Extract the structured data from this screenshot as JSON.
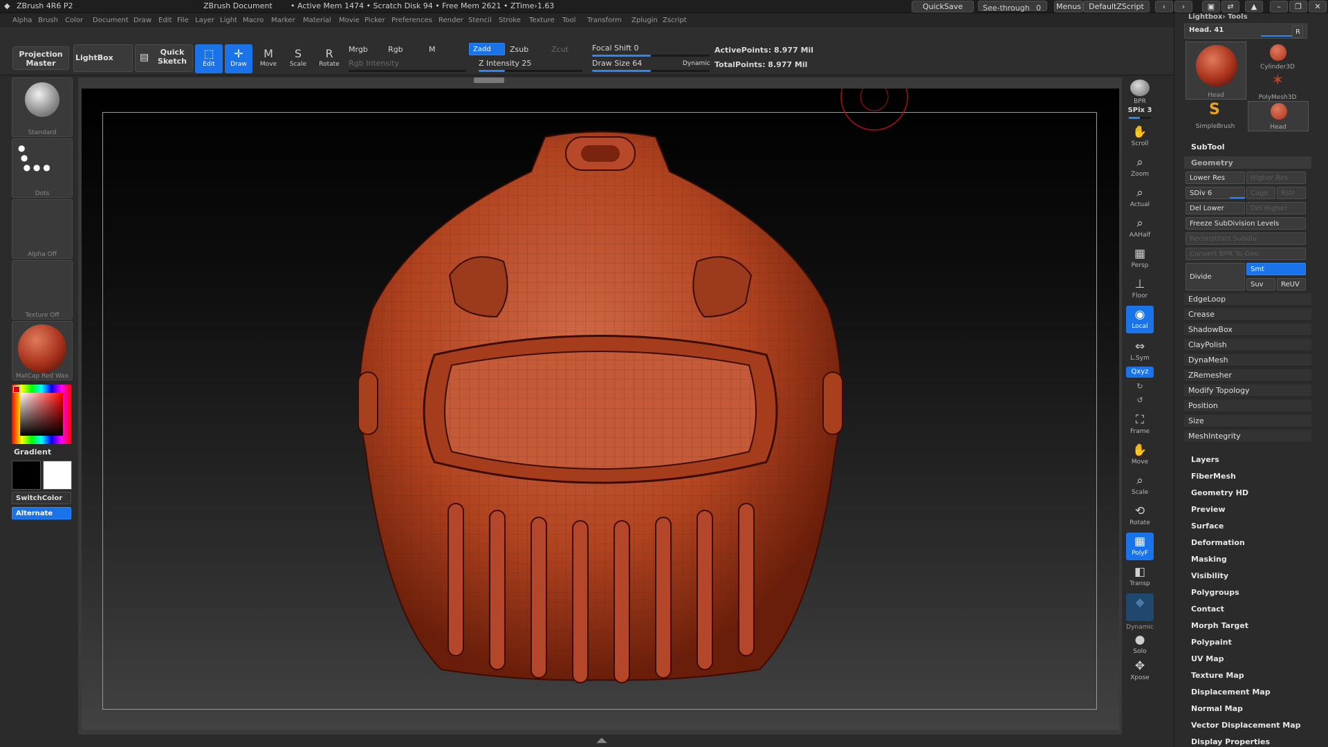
{
  "titlebar": {
    "app": "ZBrush 4R6 P2",
    "document": "ZBrush Document",
    "stats": "• Active Mem 1474 • Scratch Disk 94 • Free Mem 2621 • ZTime›1.63",
    "quicksave": "QuickSave",
    "seethrough": "See-through",
    "seethrough_value": "0",
    "menus": "Menus",
    "script": "DefaultZScript"
  },
  "menubar": [
    "Alpha",
    "Brush",
    "Color",
    "Document",
    "Draw",
    "Edit",
    "File",
    "Layer",
    "Light",
    "Macro",
    "Marker",
    "Material",
    "Movie",
    "Picker",
    "Preferences",
    "Render",
    "Stencil",
    "Stroke",
    "Texture",
    "Tool",
    "Transform",
    "Zplugin",
    "Zscript"
  ],
  "toolbar": {
    "projection_master": "Projection Master",
    "lightbox": "LightBox",
    "quick_sketch": "Quick Sketch",
    "edit": "Edit",
    "draw": "Draw",
    "move": "Move",
    "scale": "Scale",
    "rotate": "Rotate",
    "mrgb": "Mrgb",
    "rgb": "Rgb",
    "m": "M",
    "rgb_intensity": "Rgb Intensity",
    "zadd": "Zadd",
    "zsub": "Zsub",
    "zcut": "Zcut",
    "z_intensity": "Z Intensity 25",
    "focal_shift": "Focal Shift 0",
    "draw_size": "Draw Size 64",
    "dynamic": "Dynamic",
    "active_points": "ActivePoints: 8.977 Mil",
    "total_points": "TotalPoints: 8.977 Mil"
  },
  "toolbar_levels": {
    "z_intensity": 0.25,
    "focal_shift": 0.5,
    "draw_size": 0.5
  },
  "left": {
    "brush": "Standard",
    "stroke": "Dots",
    "alpha": "Alpha Off",
    "texture": "Texture Off",
    "material": "MatCap Red Wax",
    "gradient": "Gradient",
    "switchcolor": "SwitchColor",
    "alternate": "Alternate"
  },
  "right": {
    "bpr": "BPR",
    "spix": "SPix 3",
    "scroll": "Scroll",
    "zoom": "Zoom",
    "actual": "Actual",
    "aahalf": "AAHalf",
    "persp": "Persp",
    "floor": "Floor",
    "local": "Local",
    "lsym": "L.Sym",
    "xyz": "Qxyz",
    "frame": "Frame",
    "move": "Move",
    "scale": "Scale",
    "rotate": "Rotate",
    "polyf": "PolyF",
    "transp": "Transp",
    "dynamic": "Dynamic",
    "solo": "Solo",
    "xpose": "Xpose"
  },
  "toolpanel": {
    "header": "Lightbox› Tools",
    "slider": "Head. 41",
    "r": "R",
    "tools": [
      "Head",
      "Cylinder3D",
      "PolyMesh3D",
      "SimpleBrush",
      "Head"
    ],
    "subtool": "SubTool",
    "geometry": "Geometry",
    "lower_res": "Lower Res",
    "higher_res": "Higher Res",
    "sdiv": "SDiv 6",
    "cage": "Cage",
    "rstr": "Rstr",
    "del_lower": "Del Lower",
    "del_higher": "Del Higher",
    "freeze": "Freeze SubDivision Levels",
    "reconstruct": "Reconstruct Subdiv",
    "convert_bpr": "Convert BPR To Geo",
    "divide": "Divide",
    "smt": "Smt",
    "suv": "Suv",
    "reuv": "ReUV",
    "geo_items": [
      "EdgeLoop",
      "Crease",
      "ShadowBox",
      "ClayPolish",
      "DynaMesh",
      "ZRemesher",
      "Modify Topology",
      "Position",
      "Size",
      "MeshIntegrity"
    ],
    "sections": [
      "Layers",
      "FiberMesh",
      "Geometry HD",
      "Preview",
      "Surface",
      "Deformation",
      "Masking",
      "Visibility",
      "Polygroups",
      "Contact",
      "Morph Target",
      "Polypaint",
      "UV Map",
      "Texture Map",
      "Displacement Map",
      "Normal Map",
      "Vector Displacement Map",
      "Display Properties"
    ]
  },
  "colors": {
    "accent": "#1a73e8",
    "mesh": "#b84a2a",
    "panel": "#2b2b2b"
  }
}
